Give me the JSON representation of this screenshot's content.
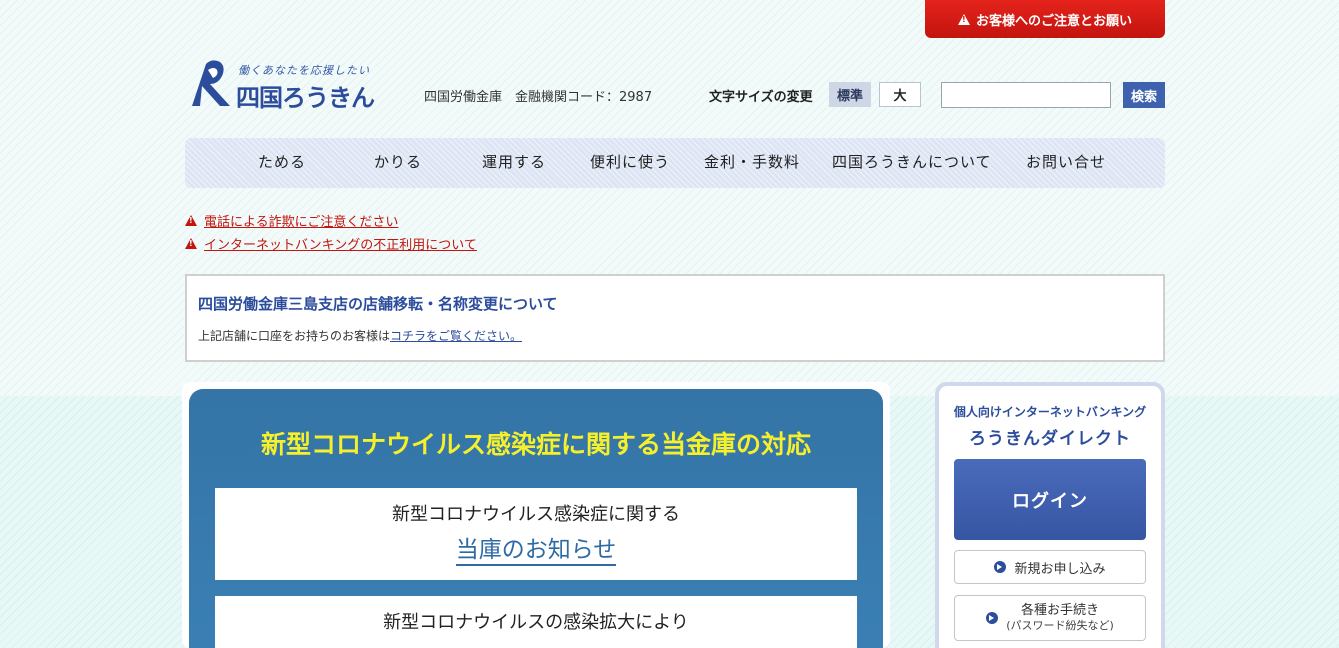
{
  "header": {
    "notice_button": "お客様へのご注意とお願い",
    "logo_tagline": "働くあなたを応援したい",
    "logo_name": "四国ろうきん",
    "bank_code": "四国労働金庫　金融機関コード：2987",
    "font_size_label": "文字サイズの変更",
    "font_size_standard": "標準",
    "font_size_large": "大",
    "search_value": "",
    "search_button": "検索"
  },
  "nav": {
    "items": [
      {
        "label": "ためる"
      },
      {
        "label": "かりる"
      },
      {
        "label": "運用する"
      },
      {
        "label": "便利に使う"
      },
      {
        "label": "金利・手数料"
      },
      {
        "label": "四国ろうきんについて"
      },
      {
        "label": "お問い合せ"
      }
    ]
  },
  "alerts": [
    {
      "label": "電話による詐欺にご注意ください"
    },
    {
      "label": "インターネットバンキングの不正利用について"
    }
  ],
  "info": {
    "title": "四国労働金庫三島支店の店舗移転・名称変更について",
    "text": "上記店舗に口座をお持ちのお客様は",
    "link": "コチラをご覧ください。"
  },
  "corona": {
    "title": "新型コロナウイルス感染症に関する当金庫の対応",
    "card1_line1": "新型コロナウイルス感染症に関する",
    "card1_line2": "当庫のお知らせ",
    "card2_line1": "新型コロナウイルスの感染拡大により"
  },
  "internet_banking": {
    "subtitle": "個人向けインターネットバンキング",
    "title": "ろうきんダイレクト",
    "login": "ログイン",
    "new_application": "新規お申し込み",
    "procedures": "各種お手続き",
    "procedures_sub": "(パスワード紛失など)"
  },
  "colors": {
    "brand_blue": "#2c4d9c",
    "alert_red": "#c3140e",
    "corona_bg": "#3474a6",
    "corona_title": "#f6ef2b"
  }
}
